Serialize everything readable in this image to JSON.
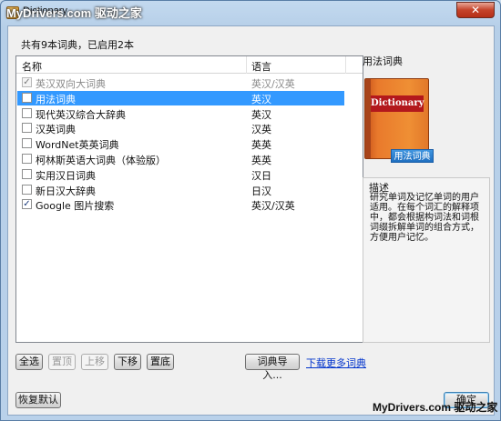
{
  "window": {
    "title": "Dictionary",
    "watermark": "MyDrivers.com 驱动之家",
    "close_label": "✕"
  },
  "summary": "共有9本词典，已启用2本",
  "table": {
    "columns": [
      "名称",
      "语言"
    ],
    "rows": [
      {
        "name": "英汉双向大词典",
        "lang": "英汉/汉英",
        "checked": true,
        "disabled": true,
        "selected": false
      },
      {
        "name": "用法词典",
        "lang": "英汉",
        "checked": false,
        "disabled": false,
        "selected": true
      },
      {
        "name": "现代英汉综合大辞典",
        "lang": "英汉",
        "checked": false,
        "disabled": false,
        "selected": false
      },
      {
        "name": "汉英词典",
        "lang": "汉英",
        "checked": false,
        "disabled": false,
        "selected": false
      },
      {
        "name": "WordNet英英词典",
        "lang": "英英",
        "checked": false,
        "disabled": false,
        "selected": false
      },
      {
        "name": "柯林斯英语大词典（体验版）",
        "lang": "英英",
        "checked": false,
        "disabled": false,
        "selected": false
      },
      {
        "name": "实用汉日词典",
        "lang": "汉日",
        "checked": false,
        "disabled": false,
        "selected": false
      },
      {
        "name": "新日汉大辞典",
        "lang": "日汉",
        "checked": false,
        "disabled": false,
        "selected": false
      },
      {
        "name": "Google 图片搜索",
        "lang": "英汉/汉英",
        "checked": true,
        "disabled": false,
        "selected": false
      }
    ]
  },
  "buttons": {
    "select_all": "全选",
    "top": "置顶",
    "up": "上移",
    "down": "下移",
    "bottom": "置底",
    "import": "词典导入...",
    "restore": "恢复默认",
    "ok": "确定"
  },
  "links": {
    "download_more": "下载更多词典"
  },
  "detail": {
    "title": "用法词典",
    "book_label": "Dictionary",
    "badge": "用法词典",
    "desc_title": "描述",
    "desc_text": "研究单词及记忆单词的用户适用。在每个词汇的解释项中，都会根据构词法和词根词缀拆解单词的组合方式，方便用户记忆。"
  },
  "footer_watermark": "MyDrivers.com 驱动之家"
}
